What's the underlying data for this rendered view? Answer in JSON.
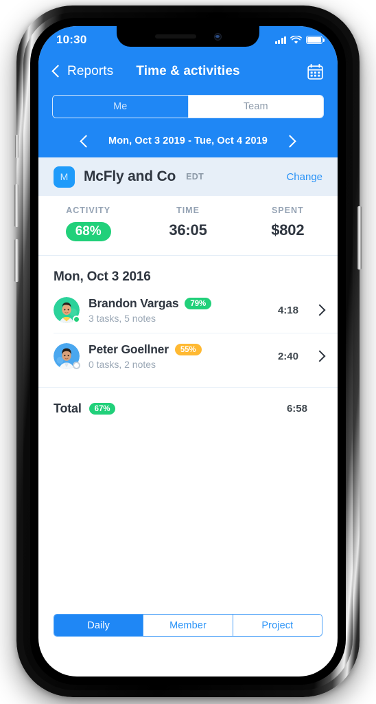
{
  "status_bar": {
    "time": "10:30",
    "signal_icon": "signal-bars-icon",
    "wifi_icon": "wifi-icon",
    "battery_icon": "battery-full-icon"
  },
  "nav": {
    "back_label": "Reports",
    "back_icon": "chevron-left-icon",
    "title": "Time & activities",
    "calendar_icon": "calendar-icon"
  },
  "scope_tabs": {
    "items": [
      {
        "label": "Me",
        "selected": true
      },
      {
        "label": "Team",
        "selected": false
      }
    ]
  },
  "date_nav": {
    "prev_icon": "chevron-left-icon",
    "next_icon": "chevron-right-icon",
    "range": "Mon, Oct 3 2019 - Tue, Oct 4 2019"
  },
  "client": {
    "avatar_initial": "M",
    "name": "McFly and Co",
    "timezone": "EDT",
    "change_label": "Change"
  },
  "stats": [
    {
      "label": "ACTIVITY",
      "value": "68%",
      "type": "pill",
      "color": "#21d07a"
    },
    {
      "label": "TIME",
      "value": "36:05",
      "type": "text"
    },
    {
      "label": "SPENT",
      "value": "$802",
      "type": "text"
    }
  ],
  "day_group": {
    "heading": "Mon, Oct 3 2016",
    "rows": [
      {
        "name": "Brandon Vargas",
        "activity": "79%",
        "activity_color": "#21d07a",
        "subtitle": "3 tasks, 5 notes",
        "time": "4:18",
        "status": "online",
        "avatar_bg": "#2bd29a",
        "chevron_icon": "chevron-right-icon"
      },
      {
        "name": "Peter Goellner",
        "activity": "55%",
        "activity_color": "#ffb932",
        "subtitle": "0 tasks, 2 notes",
        "time": "2:40",
        "status": "offline",
        "avatar_bg": "#4aa7ef",
        "chevron_icon": "chevron-right-icon"
      }
    ],
    "total": {
      "label": "Total",
      "activity": "67%",
      "activity_color": "#21d07a",
      "time": "6:58"
    }
  },
  "bottom_tabs": {
    "items": [
      {
        "label": "Daily",
        "active": true
      },
      {
        "label": "Member",
        "active": false
      },
      {
        "label": "Project",
        "active": false
      }
    ]
  },
  "theme": {
    "primary_blue": "#1f87f5",
    "green": "#21d07a",
    "amber": "#ffb932",
    "client_bar_bg": "#e7eff8",
    "text_dark": "#2f3640",
    "text_muted": "#9aa7b5"
  }
}
